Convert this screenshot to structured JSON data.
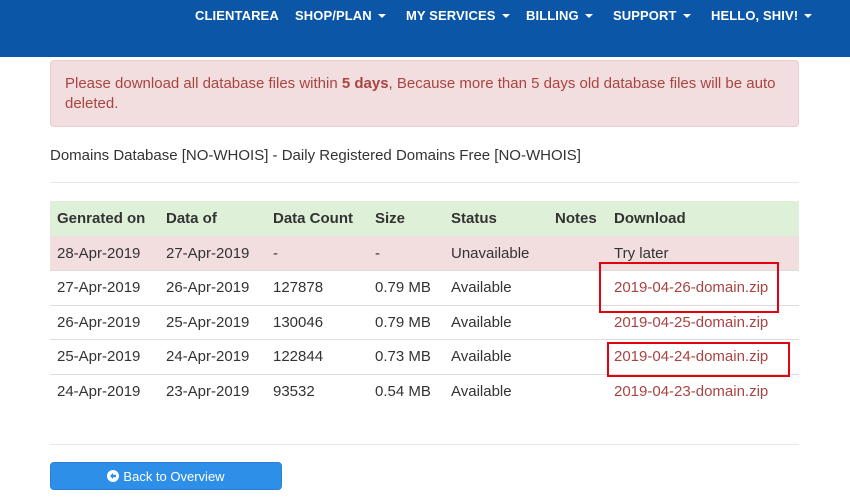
{
  "nav": {
    "items": [
      {
        "label": "CLIENTAREA",
        "has_caret": false
      },
      {
        "label": "SHOP/PLAN",
        "has_caret": true
      },
      {
        "label": "MY SERVICES",
        "has_caret": true
      },
      {
        "label": "BILLING",
        "has_caret": true
      },
      {
        "label": "SUPPORT",
        "has_caret": true
      },
      {
        "label": "HELLO, SHIV!",
        "has_caret": true
      }
    ]
  },
  "alert": {
    "text_before": "Please download all database files within ",
    "text_bold": "5 days",
    "text_after": ", Because more than 5 days old database files will be auto deleted."
  },
  "heading": "Domains Database [NO-WHOIS] - Daily Registered Domains Free [NO-WHOIS]",
  "table": {
    "headers": [
      "Genrated on",
      "Data of",
      "Data Count",
      "Size",
      "Status",
      "Notes",
      "Download"
    ],
    "rows": [
      {
        "generated": "28-Apr-2019",
        "data_of": "27-Apr-2019",
        "count": "-",
        "size": "-",
        "status": "Unavailable",
        "notes": "",
        "download": "Try later",
        "is_link": false,
        "danger": true
      },
      {
        "generated": "27-Apr-2019",
        "data_of": "26-Apr-2019",
        "count": "127878",
        "size": "0.79 MB",
        "status": "Available",
        "notes": "",
        "download": "2019-04-26-domain.zip",
        "is_link": true,
        "danger": false
      },
      {
        "generated": "26-Apr-2019",
        "data_of": "25-Apr-2019",
        "count": "130046",
        "size": "0.79 MB",
        "status": "Available",
        "notes": "",
        "download": "2019-04-25-domain.zip",
        "is_link": true,
        "danger": false
      },
      {
        "generated": "25-Apr-2019",
        "data_of": "24-Apr-2019",
        "count": "122844",
        "size": "0.73 MB",
        "status": "Available",
        "notes": "",
        "download": "2019-04-24-domain.zip",
        "is_link": true,
        "danger": false
      },
      {
        "generated": "24-Apr-2019",
        "data_of": "23-Apr-2019",
        "count": "93532",
        "size": "0.54 MB",
        "status": "Available",
        "notes": "",
        "download": "2019-04-23-domain.zip",
        "is_link": true,
        "danger": false
      }
    ]
  },
  "back_button": {
    "label": "Back to Overview",
    "icon": "arrow-circle-left-icon"
  },
  "colors": {
    "nav_bg": "#0b56a6",
    "alert_text": "#a94442",
    "header_row": "#dff0d8",
    "danger_row": "#f2dede",
    "button": "#2e8fe8",
    "highlight": "#e3000f"
  }
}
